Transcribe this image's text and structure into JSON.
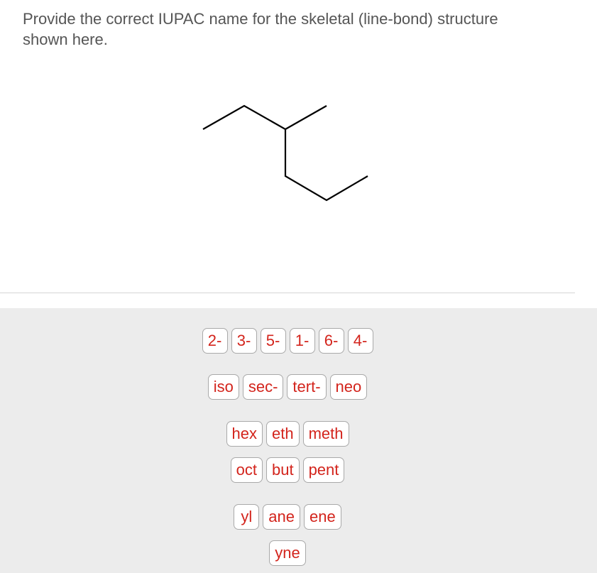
{
  "question": {
    "text": "Provide the correct IUPAC name for the skeletal (line-bond) structure shown here."
  },
  "structure": {
    "description": "skeletal line-bond structure",
    "stroke_color": "#000000"
  },
  "tiles": {
    "locants": [
      "2-",
      "3-",
      "5-",
      "1-",
      "6-",
      "4-"
    ],
    "prefixes": [
      "iso",
      "sec-",
      "tert-",
      "neo"
    ],
    "roots_row1": [
      "hex",
      "eth",
      "meth"
    ],
    "roots_row2": [
      "oct",
      "but",
      "pent"
    ],
    "suffixes_row1": [
      "yl",
      "ane",
      "ene"
    ],
    "suffixes_row2": [
      "yne"
    ]
  },
  "colors": {
    "tile_text": "#d3241c",
    "panel_bg": "#ececec",
    "question_text": "#555555"
  }
}
